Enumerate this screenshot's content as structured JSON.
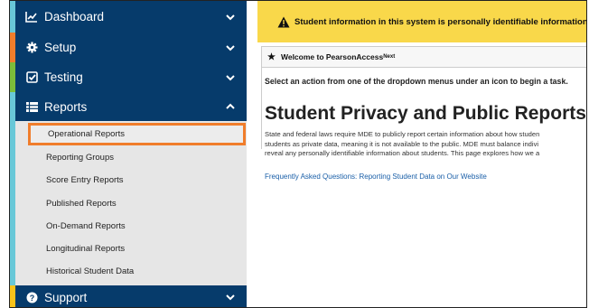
{
  "sidebar": {
    "items": [
      {
        "label": "Dashboard",
        "icon": "chart-line-icon",
        "accent": "#68c8d8"
      },
      {
        "label": "Setup",
        "icon": "gear-icon",
        "accent": "#f07d2b"
      },
      {
        "label": "Testing",
        "icon": "checkbox-icon",
        "accent": "#7bbd3a"
      },
      {
        "label": "Reports",
        "icon": "list-icon",
        "accent": "#68c8d8"
      },
      {
        "label": "Support",
        "icon": "question-circle-icon",
        "accent": "#f9c31a"
      }
    ],
    "reports_submenu": [
      "Operational Reports",
      "Reporting Groups",
      "Score Entry Reports",
      "Published Reports",
      "On-Demand Reports",
      "Longitudinal Reports",
      "Historical Student Data"
    ],
    "highlighted_item": "Operational Reports"
  },
  "banner": {
    "text": "Student information in this system is personally identifiable information (PII):",
    "icon": "warning-icon",
    "color": "#f9d84a"
  },
  "welcome": {
    "text": "Welcome to PearsonAccess",
    "superscript": "Next"
  },
  "main": {
    "instruction": "Select an action from one of the dropdown menus under an icon to begin a task.",
    "title": "Student Privacy and Public Reports",
    "paragraph_lines": [
      "State and federal laws require MDE to publicly report certain information about how studen",
      "students as private data, meaning it is not available to the public. MDE must balance indivi",
      "reveal any personally identifiable information about students. This page explores how we a"
    ],
    "faq_link": "Frequently Asked Questions: Reporting Student Data on Our Website"
  },
  "colors": {
    "nav_bg": "#063b6b",
    "highlight_border": "#f07d2b",
    "link": "#1a5fa8"
  }
}
